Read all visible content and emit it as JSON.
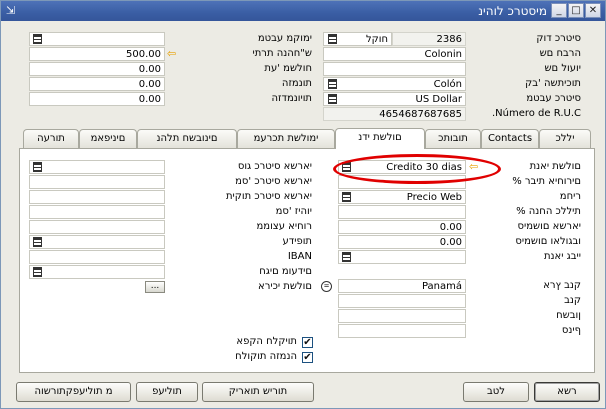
{
  "window": {
    "title": "מיסטרכ לוהינ",
    "controls": {
      "minimize": "_",
      "maximize": "□",
      "close": "✕"
    }
  },
  "header": {
    "right": [
      {
        "label": "סיטרכ דוק",
        "value": "2386",
        "extra": "חוקל"
      },
      {
        "label": "הרבח םש",
        "value": "Colonin"
      },
      {
        "label": "יועול םש",
        "value": ""
      },
      {
        "label": "תוכיתשה 'בק",
        "value": "Colón"
      },
      {
        "label": "סיטרכ עבטמ",
        "value": "US Dollar"
      },
      {
        "label": "Número de R.U.C.",
        "value": "4654687687685"
      }
    ],
    "left": [
      {
        "label": "ימוקמ עבטמ",
        "value": ""
      },
      {
        "label": "ש\"חהנה תרתי",
        "value": "500.00"
      },
      {
        "label": "חולשמ 'עת",
        "value": "0.00"
      },
      {
        "label": "תונמזה",
        "value": "0.00"
      },
      {
        "label": "תויונמדזה",
        "value": "0.00"
      }
    ]
  },
  "tabs": [
    "יללכ",
    "Contacts",
    "תובותכ",
    "םולשת ידנ",
    "ימולשת תכרעמ",
    "םינובשח תלהנ",
    "םיניפאמ",
    "תורעה"
  ],
  "payment_tab": {
    "right": [
      {
        "label": "םולשת יאנת",
        "value": "Credito 30 dias"
      },
      {
        "label": "םירוחיא תיבר %",
        "value": ""
      },
      {
        "label": "ריחמ",
        "value": "Precio Web"
      },
      {
        "label": "תיללכ החנה %",
        "value": ""
      },
      {
        "label": "יארשא םושמיס",
        "value": "0.00"
      },
      {
        "label": "ובגולאו םושמיס",
        "value": "0.00"
      },
      {
        "label": "ייבג יאנת",
        "value": ""
      },
      {
        "label": "קנב ץרא",
        "value": "Panamá"
      },
      {
        "label": "קנב",
        "value": ""
      },
      {
        "label": "ןובשח",
        "value": ""
      },
      {
        "label": "ףינס",
        "value": ""
      }
    ],
    "left": [
      {
        "label": "יארשא סיטרכ גוס",
        "value": ""
      },
      {
        "label": "יארשא סיטרכ 'סמ",
        "value": ""
      },
      {
        "label": "יארשא סיטרכ תוקית",
        "value": ""
      },
      {
        "label": "יוהיז 'סמ",
        "value": ""
      },
      {
        "label": "רוחיא עצוממ",
        "value": ""
      },
      {
        "label": "תופידע",
        "value": ""
      },
      {
        "label": "IBAN",
        "value": ""
      },
      {
        "label": "םידעומ םיגח",
        "value": ""
      },
      {
        "label": "םולשת יכירא",
        "value": "..."
      }
    ],
    "checkboxes": [
      {
        "label": "תויקלח הקפא",
        "checked": true
      },
      {
        "label": "הנמזה תוקולח",
        "checked": true
      }
    ]
  },
  "buttons": {
    "ok": "רשא",
    "cancel": "לטב",
    "debtor_plan": "תוריש תואריק",
    "activities": "תוליעפ",
    "related": "מ תוליעפקתורשוה"
  },
  "icons": {
    "list": "list-icon",
    "arrow": "arrow-right-icon",
    "circle": "equal-circle-icon"
  },
  "colors": {
    "titlebar": "#3a5ea4",
    "highlight_ring": "#e00000",
    "arrow": "#e8a000",
    "background": "#ecebe4"
  }
}
